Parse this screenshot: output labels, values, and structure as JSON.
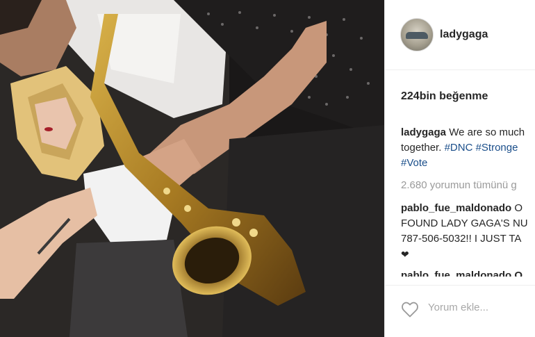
{
  "post": {
    "username": "ladygaga",
    "likes": "224bin beğenme",
    "caption_user": "ladygaga",
    "caption_text": " We are so much",
    "caption_line2_prefix": "together. ",
    "hashtags": [
      "#DNC",
      "#Stronge",
      "#Vote"
    ],
    "view_comments": "2.680 yorumun tümünü g",
    "comment_user": "pablo_fue_maldonado",
    "comment_text_1": " O",
    "comment_line2": "FOUND LADY GAGA'S NU",
    "comment_line3": "787-506-5032!! I JUST TA",
    "comment2_user": "pablo_fue_maldonado",
    "comment2_text": " O",
    "add_comment_placeholder": "Yorum ekle...",
    "icons": {
      "like": "heart-outline-icon",
      "comment_heart": "heart-filled-icon"
    }
  }
}
